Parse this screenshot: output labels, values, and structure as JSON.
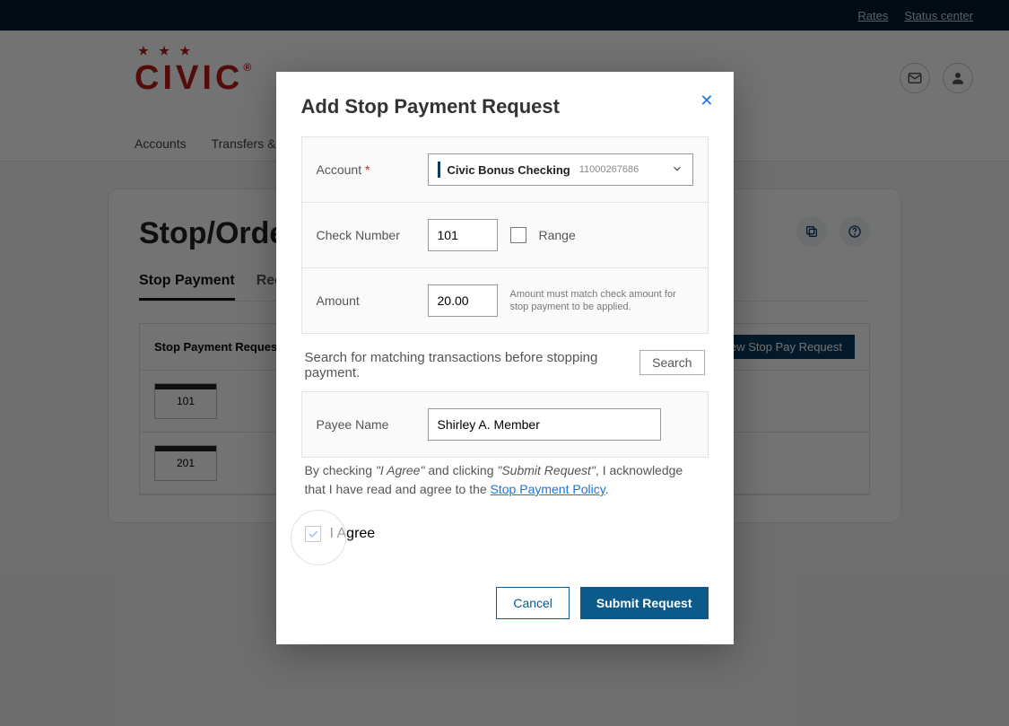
{
  "top_links": {
    "rates": "Rates",
    "status_center": "Status center"
  },
  "brand": {
    "name": "civic",
    "stars": "★ ★ ★"
  },
  "nav": {
    "item1": "Accounts",
    "item2": "Transfers & Pa"
  },
  "page": {
    "title": "Stop/Order",
    "tab_stop": "Stop Payment",
    "tab_reorder": "Reorde",
    "requests_header": "Stop Payment Requests",
    "new_btn": "New Stop Pay Request",
    "rows": [
      {
        "num": "101"
      },
      {
        "num": "201"
      }
    ]
  },
  "modal": {
    "title": "Add Stop Payment Request",
    "account_label": "Account",
    "account_name": "Civic Bonus Checking",
    "account_number": "11000267686",
    "check_label": "Check Number",
    "check_value": "101",
    "range_label": "Range",
    "amount_label": "Amount",
    "amount_value": "20.00",
    "amount_hint": "Amount must match check amount for stop payment to be applied.",
    "search_text": "Search for matching transactions before stopping payment.",
    "search_btn": "Search",
    "payee_label": "Payee Name",
    "payee_value": "Shirley A. Member",
    "agree_pre": "By checking ",
    "agree_i": "\"I Agree\"",
    "agree_mid": " and clicking ",
    "agree_sub": "\"Submit Request\"",
    "agree_post": ", I acknowledge that I have read and agree to the ",
    "policy": "Stop Payment Policy",
    "agree_label": "I Agree",
    "cancel": "Cancel",
    "submit": "Submit Request"
  }
}
